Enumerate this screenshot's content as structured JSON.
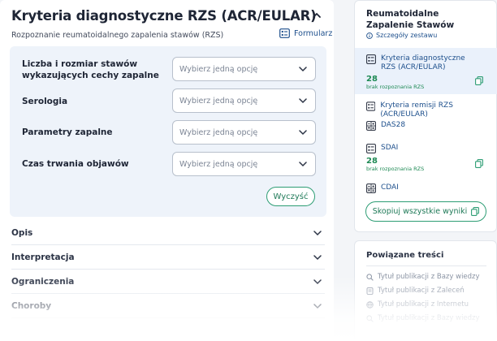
{
  "main": {
    "title": "Kryteria diagnostyczne RZS (ACR/EULAR)",
    "subtitle": "Rozpoznanie reumatoidalnego zapalenia stawów (RZS)",
    "form_link": "Formularz",
    "fields": [
      {
        "label": "Liczba i rozmiar stawów wykazujących cechy zapalne",
        "placeholder": "Wybierz jedną opcję"
      },
      {
        "label": "Serologia",
        "placeholder": "Wybierz jedną opcję"
      },
      {
        "label": "Parametry zapalne",
        "placeholder": "Wybierz jedną opcję"
      },
      {
        "label": "Czas trwania objawów",
        "placeholder": "Wybierz jedną opcję"
      }
    ],
    "clear_button": "Wyczyść",
    "sections": [
      "Opis",
      "Interpretacja",
      "Ograniczenia",
      "Choroby"
    ]
  },
  "sidebar": {
    "title": "Reumatoidalne Zapalenie Stawów",
    "details_link": "Szczegóły zestawu",
    "items": [
      {
        "label": "Kryteria diagnostyczne RZS (ACR/EULAR)",
        "score": "28",
        "note": "brak rozpoznania RZS"
      },
      {
        "label": "Kryteria remisji RZS (ACR/EULAR)"
      },
      {
        "label": "DAS28"
      },
      {
        "label": "SDAI",
        "score": "28",
        "note": "brak rozpoznania RZS"
      },
      {
        "label": "CDAI"
      }
    ],
    "copy_all_button": "Skopiuj wszystkie wyniki"
  },
  "related": {
    "title": "Powiązane treści",
    "items": [
      "Tytuł publikacji z Bazy wiedzy",
      "Tytuł publikacji z Zaleceń",
      "Tytuł publikacji z Internetu",
      "Tytuł publikacji z Bazy wiedzy"
    ]
  },
  "colors": {
    "accent_green": "#2d9d74",
    "link_blue": "#1d4f8c",
    "panel_bg": "#eef3fa"
  }
}
